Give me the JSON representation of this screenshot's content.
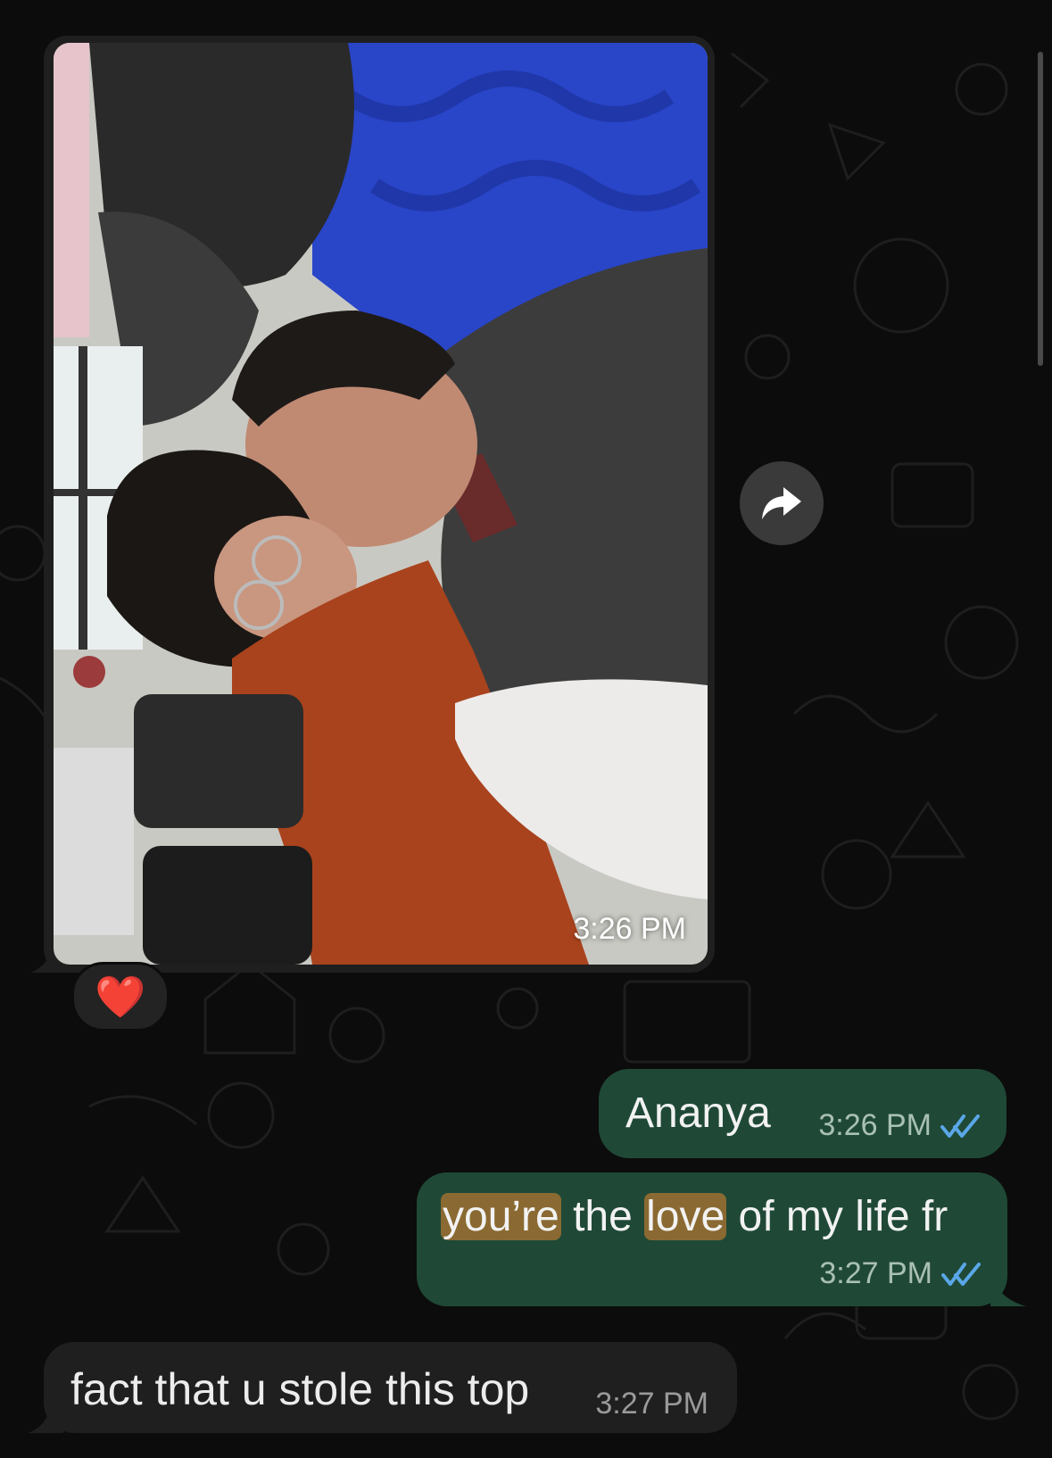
{
  "messages": [
    {
      "direction": "incoming",
      "kind": "image",
      "time": "3:26 PM",
      "reaction": "❤️"
    },
    {
      "direction": "outgoing",
      "kind": "text",
      "text": "Ananya",
      "time": "3:26 PM",
      "status": "read"
    },
    {
      "direction": "outgoing",
      "kind": "text",
      "text_parts": [
        "you’re",
        " the ",
        "love",
        " of my life fr"
      ],
      "highlighted_words": [
        "you’re",
        "love"
      ],
      "time": "3:27 PM",
      "status": "read"
    },
    {
      "direction": "incoming",
      "kind": "text",
      "text": "fact that u stole this top",
      "time": "3:27 PM"
    }
  ],
  "icons": {
    "forward": "forward-arrow-icon",
    "read_receipt": "double-check-icon",
    "reaction": "red-heart"
  },
  "colors": {
    "background": "#0c0c0c",
    "incoming_bubble": "#1f1f1f",
    "outgoing_bubble": "#1f4936",
    "highlight": "#8a6a32",
    "read_check": "#5aa7e8"
  }
}
